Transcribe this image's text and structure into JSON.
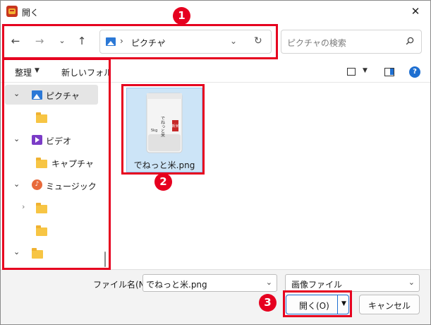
{
  "window": {
    "title": "開く",
    "close_glyph": "✕"
  },
  "nav": {
    "back_glyph": "←",
    "forward_glyph": "→",
    "recent_glyph": "⌄",
    "up_glyph": "↑",
    "address": {
      "path_label": "ピクチャ",
      "sep": "›",
      "dropdown_glyph": "⌄",
      "refresh_glyph": "↻"
    },
    "search_placeholder": "ピクチャの検索"
  },
  "toolbar": {
    "organize_label": "整理",
    "organize_caret": "▼",
    "new_folder_label": "新しいフォルダー",
    "view_caret": "▼",
    "help_label": "?"
  },
  "sidebar": {
    "items": [
      {
        "label": "ピクチャ",
        "icon": "pictures-icon",
        "expanded": true,
        "selected": true
      },
      {
        "label": "",
        "icon": "folder-icon"
      },
      {
        "label": "ビデオ",
        "icon": "video-icon",
        "expanded": true
      },
      {
        "label": "キャプチャ",
        "icon": "folder-icon"
      },
      {
        "label": "ミュージック",
        "icon": "music-icon",
        "expanded": true
      },
      {
        "label": "",
        "icon": "folder-icon",
        "collapsed": true
      },
      {
        "label": "",
        "icon": "folder-icon"
      },
      {
        "label": "",
        "icon": "folder-icon",
        "expanded": true
      }
    ],
    "chevron_down": "⌄",
    "chevron_right": "›",
    "music_glyph": "♪"
  },
  "content": {
    "files": [
      {
        "name": "でねっと米.png",
        "selected": true,
        "thumb_text": "でねっと米",
        "thumb_tag": "新米",
        "thumb_weight": "5kg"
      }
    ]
  },
  "footer": {
    "filename_label": "ファイル名(N):",
    "filename_value": "でねっと米.png",
    "dropdown_glyph": "⌄",
    "filetype_value": "画像ファイル",
    "open_label": "開く(O)",
    "open_caret": "▼",
    "cancel_label": "キャンセル"
  },
  "annotations": [
    {
      "number": "1"
    },
    {
      "number": "2"
    },
    {
      "number": "3"
    }
  ],
  "colors": {
    "annotation": "#e6001f",
    "accent": "#1e6fd1",
    "selection": "#cce4f7"
  }
}
